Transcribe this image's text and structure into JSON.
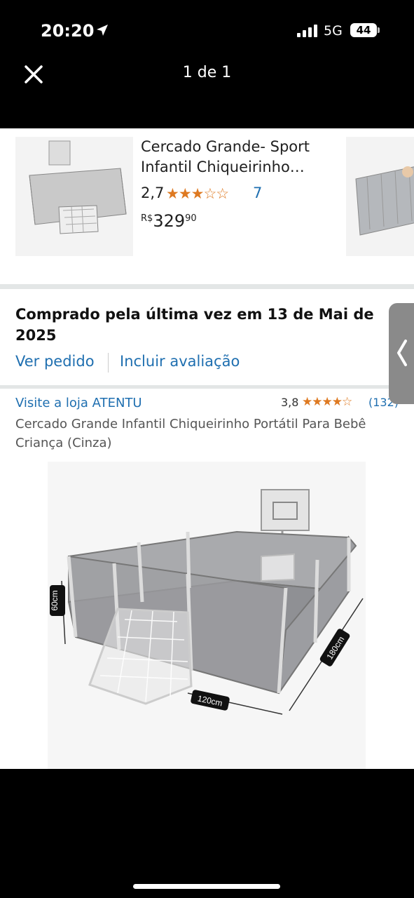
{
  "status_bar": {
    "time": "20:20",
    "network": "5G",
    "battery": "44"
  },
  "viewer": {
    "page_counter": "1 de 1"
  },
  "recommendation": {
    "title_line1": "Cercado Grande- Sport",
    "title_line2": "Infantil Chiqueirinho…",
    "rating": "2,7",
    "stars": "★★★☆☆",
    "review_count": "7",
    "price_currency": "R$",
    "price_whole": "329",
    "price_cents": "90"
  },
  "order": {
    "title": "Comprado pela última vez em 13 de Mai de 2025",
    "view_order": "Ver pedido",
    "add_review": "Incluir avaliação"
  },
  "product": {
    "store_link": "Visite a loja ATENTU",
    "rating": "3,8",
    "stars": "★★★★☆",
    "review_count": "(132)",
    "title": "Cercado Grande Infantil Chiqueirinho Portátil Para Bebê Criança (Cinza)",
    "dim_height": "60cm",
    "dim_width": "120cm",
    "dim_length": "180cm"
  },
  "colors": {
    "link": "#1f6fb0",
    "star": "#de7921",
    "divider": "#e3e6e6"
  }
}
